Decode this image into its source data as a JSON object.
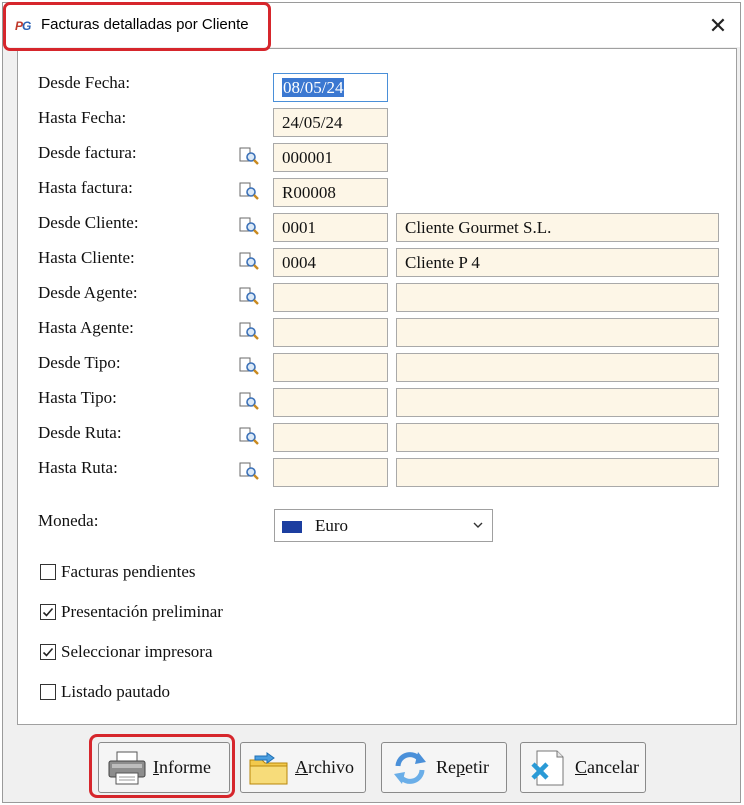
{
  "window": {
    "title": "Facturas detalladas por Cliente",
    "close_glyph": "✕",
    "app_icon_p": "P",
    "app_icon_g": "G"
  },
  "form": {
    "desde_fecha": {
      "label": "Desde Fecha:",
      "value": "08/05/24"
    },
    "hasta_fecha": {
      "label": "Hasta Fecha:",
      "value": "24/05/24"
    },
    "desde_factura": {
      "label": "Desde factura:",
      "value": "000001"
    },
    "hasta_factura": {
      "label": "Hasta factura:",
      "value": "R00008"
    },
    "desde_cliente": {
      "label": "Desde Cliente:",
      "code": "0001",
      "name": "Cliente Gourmet S.L."
    },
    "hasta_cliente": {
      "label": "Hasta Cliente:",
      "code": "0004",
      "name": "Cliente P 4"
    },
    "desde_agente": {
      "label": "Desde Agente:",
      "code": "",
      "name": ""
    },
    "hasta_agente": {
      "label": "Hasta Agente:",
      "code": "",
      "name": ""
    },
    "desde_tipo": {
      "label": "Desde Tipo:",
      "code": "",
      "name": ""
    },
    "hasta_tipo": {
      "label": "Hasta Tipo:",
      "code": "",
      "name": ""
    },
    "desde_ruta": {
      "label": "Desde Ruta:",
      "code": "",
      "name": ""
    },
    "hasta_ruta": {
      "label": "Hasta Ruta:",
      "code": "",
      "name": ""
    },
    "moneda": {
      "label": "Moneda:",
      "value": "Euro"
    }
  },
  "options": {
    "facturas_pendientes": {
      "label": "Facturas pendientes",
      "checked": false
    },
    "presentacion_preliminar": {
      "label": "Presentación preliminar",
      "checked": true
    },
    "seleccionar_impresora": {
      "label": "Seleccionar impresora",
      "checked": true
    },
    "listado_pautado": {
      "label": "Listado pautado",
      "checked": false
    }
  },
  "buttons": {
    "informe": {
      "first": "I",
      "rest": "nforme"
    },
    "archivo": {
      "first": "A",
      "rest": "rchivo"
    },
    "repetir": {
      "pre": "Re",
      "underlined": "p",
      "post": "etir"
    },
    "cancelar": {
      "first": "C",
      "rest": "ancelar"
    }
  },
  "colors": {
    "highlight": "#d6262c",
    "field_bg": "#fdf6e7",
    "selection": "#3b78d1"
  }
}
